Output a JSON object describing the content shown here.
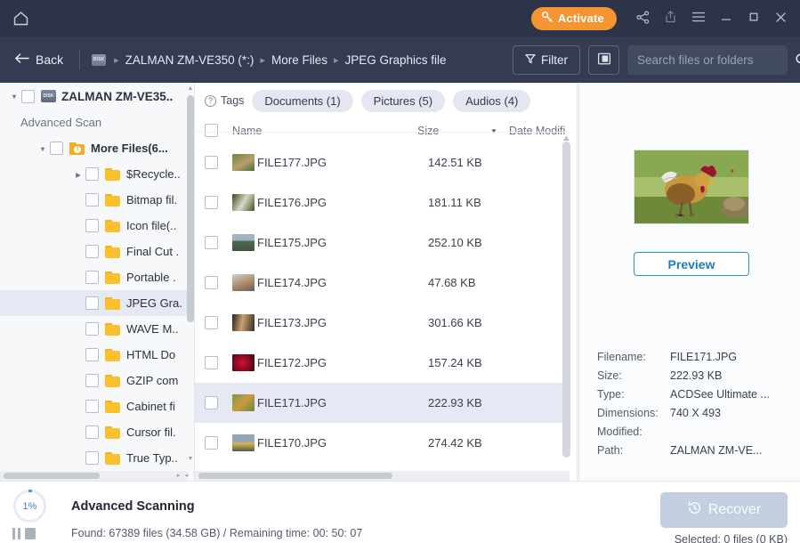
{
  "titlebar": {
    "home_icon": "home-icon",
    "activate_label": "Activate",
    "activate_icon": "key-icon",
    "share_icon": "share-icon",
    "export_icon": "upload-icon",
    "menu_icon": "hamburger-menu-icon",
    "minimize_icon": "minimize-icon",
    "maximize_icon": "maximize-icon",
    "close_icon": "close-icon",
    "accent_orange": "#f59432",
    "bar_bg": "#2e3448"
  },
  "toolbar": {
    "back_label": "Back",
    "disk_icon_label": "DISK",
    "breadcrumbs": [
      "ZALMAN  ZM-VE350  (*:)",
      "More Files",
      "JPEG Graphics file"
    ],
    "filter_label": "Filter",
    "panel_toggle_icon": "side-panel-icon",
    "search_placeholder": "Search files or folders",
    "search_value": "",
    "bar_bg": "#353c52"
  },
  "sidebar": {
    "root": {
      "label": "ZALMAN  ZM-VE35..",
      "expanded": true
    },
    "advanced_scan_label": "Advanced Scan",
    "group": {
      "label": "More Files(6...",
      "expanded": true
    },
    "items": [
      {
        "label": "$Recycle..",
        "has_caret": true
      },
      {
        "label": "Bitmap fil.",
        "has_caret": false
      },
      {
        "label": "Icon file(..",
        "has_caret": false
      },
      {
        "label": "Final Cut .",
        "has_caret": false
      },
      {
        "label": "Portable .",
        "has_caret": false
      },
      {
        "label": "JPEG Gra.",
        "has_caret": false,
        "selected": true
      },
      {
        "label": "WAVE M..",
        "has_caret": false
      },
      {
        "label": "HTML Do",
        "has_caret": false
      },
      {
        "label": "GZIP com",
        "has_caret": false
      },
      {
        "label": "Cabinet fi",
        "has_caret": false
      },
      {
        "label": "Cursor fil.",
        "has_caret": false
      },
      {
        "label": "True Typ..",
        "has_caret": false
      }
    ]
  },
  "filelist": {
    "tags_label": "Tags",
    "chips": [
      "Documents (1)",
      "Pictures (5)",
      "Audios (4)"
    ],
    "columns": {
      "name": "Name",
      "size": "Size",
      "date": "Date Modifi"
    },
    "sort_indicator": "descending-arrow-icon",
    "rows": [
      {
        "name": "FILE177.JPG",
        "size": "142.51 KB",
        "thumb": "#8a9463",
        "selected": false
      },
      {
        "name": "FILE176.JPG",
        "size": "181.11 KB",
        "thumb": "#5c7340",
        "selected": false
      },
      {
        "name": "FILE175.JPG",
        "size": "252.10 KB",
        "thumb": "#6d7f8e",
        "selected": false
      },
      {
        "name": "FILE174.JPG",
        "size": "47.68 KB",
        "thumb": "#a08d78",
        "selected": false
      },
      {
        "name": "FILE173.JPG",
        "size": "301.66 KB",
        "thumb": "#6b5236",
        "selected": false
      },
      {
        "name": "FILE172.JPG",
        "size": "157.24 KB",
        "thumb": "#8d1224",
        "selected": false
      },
      {
        "name": "FILE171.JPG",
        "size": "222.93 KB",
        "thumb": "#7f8f4a",
        "selected": true
      },
      {
        "name": "FILE170.JPG",
        "size": "274.42 KB",
        "thumb": "#7e8d9a",
        "selected": false
      }
    ]
  },
  "preview": {
    "image_alt": "rooster-photo-thumbnail",
    "button_label": "Preview",
    "meta": [
      {
        "key": "Filename:",
        "value": "FILE171.JPG"
      },
      {
        "key": "Size:",
        "value": "222.93 KB"
      },
      {
        "key": "Type:",
        "value": "ACDSee Ultimate ..."
      },
      {
        "key": "Dimensions:",
        "value": "740 X 493"
      },
      {
        "key": "Modified:",
        "value": ""
      },
      {
        "key": "Path:",
        "value": "ZALMAN  ZM-VE..."
      }
    ]
  },
  "bottom": {
    "progress_percent": "1%",
    "progress_value": 1,
    "status_title": "Advanced Scanning",
    "status_detail": "Found: 67389 files (34.58 GB) / Remaining time: 00: 50: 07",
    "pause_icon": "pause-icon",
    "stop_icon": "stop-icon",
    "recover_label": "Recover",
    "recover_icon": "restore-clock-icon",
    "selected_info": "Selected: 0 files (0 KB)"
  }
}
